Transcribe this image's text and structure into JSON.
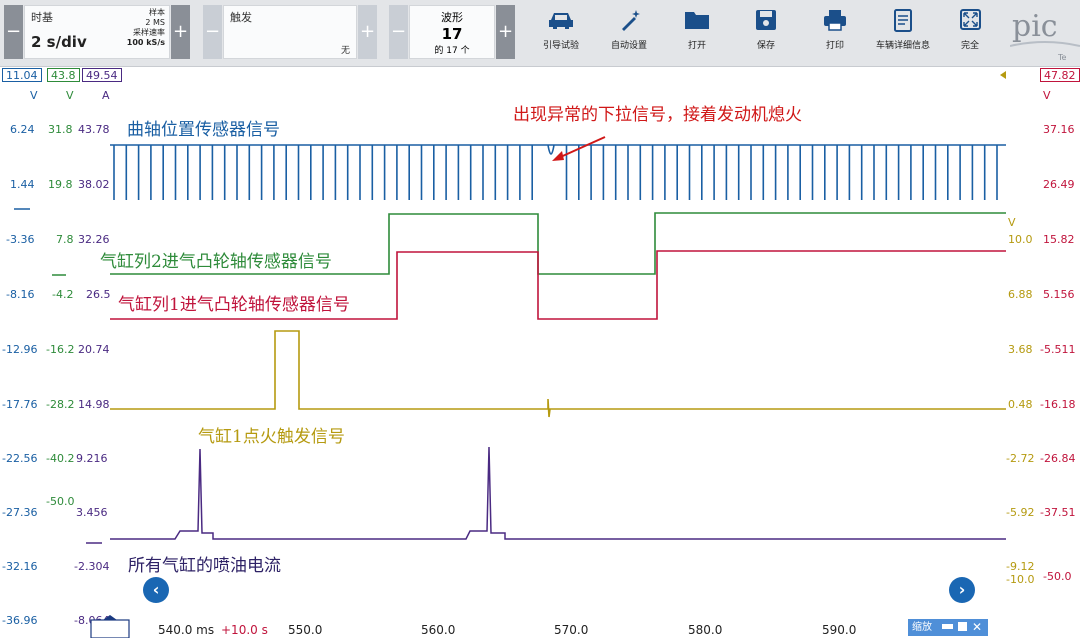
{
  "toolbar": {
    "timebase": {
      "title": "时基",
      "value": "2 s/div",
      "samples_label": "样本",
      "samples": "2 MS",
      "rate_label": "采样速率",
      "rate": "100 kS/s"
    },
    "trigger": {
      "title": "触发",
      "mode": "无"
    },
    "waveform": {
      "title": "波形",
      "current": "17",
      "total": "的 17 个"
    },
    "tools": [
      {
        "icon": "car-icon",
        "label": "引导试验"
      },
      {
        "icon": "wand-icon",
        "label": "自动设置"
      },
      {
        "icon": "folder-icon",
        "label": "打开"
      },
      {
        "icon": "save-icon",
        "label": "保存"
      },
      {
        "icon": "print-icon",
        "label": "打印"
      },
      {
        "icon": "clipboard-icon",
        "label": "车辆详细信息"
      },
      {
        "icon": "fullscreen-icon",
        "label": "完全"
      }
    ],
    "plus": "+",
    "minus": "−"
  },
  "channels": {
    "blue": {
      "range": "11.04",
      "unit": "V",
      "color": "#1a5fa3"
    },
    "green": {
      "range": "43.8",
      "unit": "V",
      "color": "#2e8b3a"
    },
    "purple": {
      "range": "49.54",
      "unit": "A",
      "color": "#4a2a82"
    },
    "yellow": {
      "unit": "V",
      "color": "#b59a10"
    },
    "red": {
      "range": "47.82",
      "unit": "V",
      "color": "#c0143c"
    }
  },
  "left_axes": {
    "blue": [
      "6.24",
      "1.44",
      "-3.36",
      "-8.16",
      "-12.96",
      "-17.76",
      "-22.56",
      "-27.36",
      "-32.16",
      "-36.96"
    ],
    "green": [
      "31.8",
      "19.8",
      "7.8",
      "-4.2",
      "-16.2",
      "-28.2",
      "-40.2",
      "-50.0"
    ],
    "purple": [
      "43.78",
      "38.02",
      "32.26",
      "26.5",
      "20.74",
      "14.98",
      "9.216",
      "3.456",
      "-2.304",
      "-8.064"
    ]
  },
  "right_axes": {
    "yellow": [
      "10.0",
      "6.88",
      "3.68",
      "0.48",
      "-2.72",
      "-5.92",
      "-9.12",
      "-10.0"
    ],
    "red": [
      "37.16",
      "26.49",
      "15.82",
      "5.156",
      "-5.511",
      "-16.18",
      "-26.84",
      "-37.51",
      "-50.0"
    ]
  },
  "x_axis": {
    "start": "540.0 ms",
    "offset": "+10.0 s",
    "ticks": [
      "550.0",
      "560.0",
      "570.0",
      "580.0",
      "590.0"
    ]
  },
  "annotations": {
    "crank": "曲轴位置传感器信号",
    "abnormal": "出现异常的下拉信号，接着发动机熄火",
    "cam2": "气缸列2进气凸轮轴传感器信号",
    "cam1": "气缸列1进气凸轮轴传感器信号",
    "ignition": "气缸1点火触发信号",
    "injector": "所有气缸的喷油电流"
  },
  "controls": {
    "prev": "‹",
    "next": "›",
    "zoom_label": "缩放"
  }
}
